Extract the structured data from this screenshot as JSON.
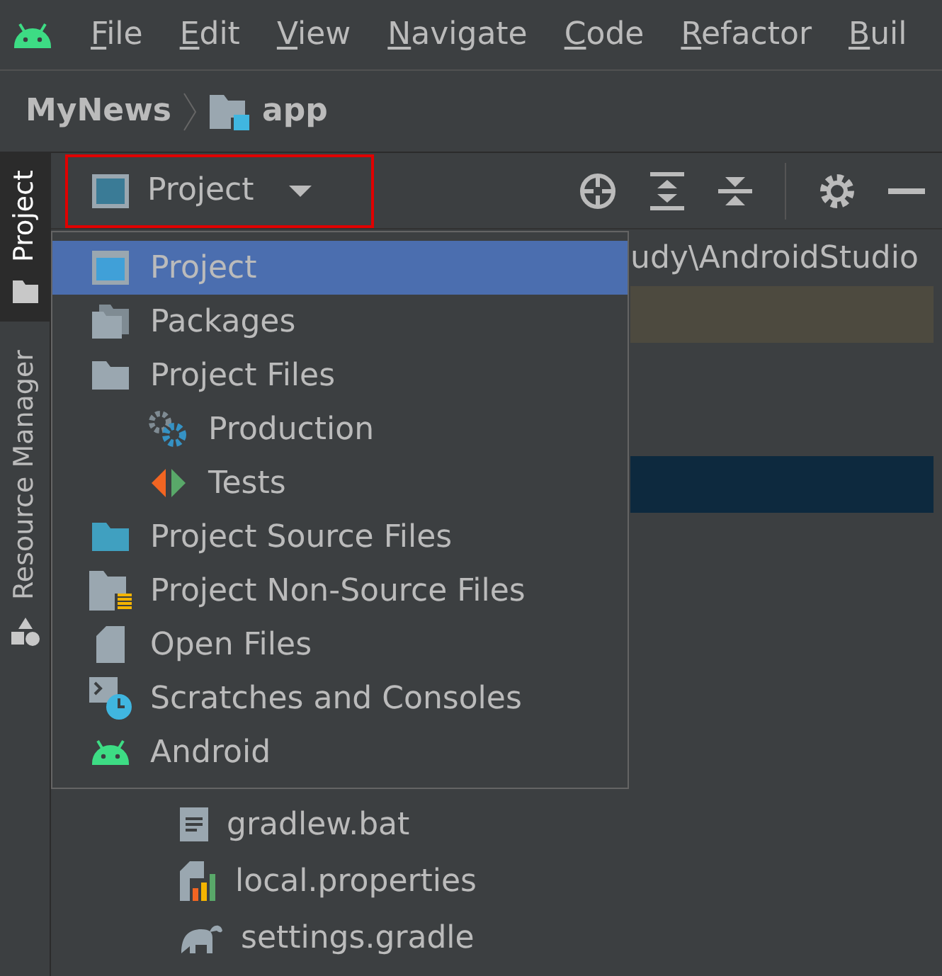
{
  "menu_bar": [
    "File",
    "Edit",
    "View",
    "Navigate",
    "Code",
    "Refactor",
    "Buil"
  ],
  "breadcrumb": {
    "project": "MyNews",
    "module": "app"
  },
  "side_tabs": [
    {
      "label": "Project",
      "selected": true,
      "kind": "folder"
    },
    {
      "label": "Resource Manager",
      "selected": false,
      "kind": "shapes"
    }
  ],
  "view_selector": {
    "label": "Project",
    "highlighted": true
  },
  "tree_rows": [
    {
      "label": "udy\\AndroidStudio",
      "kind": "path"
    },
    {
      "kind": "modified-row"
    },
    {
      "kind": "spacer"
    },
    {
      "kind": "spacer"
    },
    {
      "kind": "selected-row"
    },
    {
      "kind": "spacer"
    },
    {
      "kind": "spacer"
    },
    {
      "kind": "spacer"
    },
    {
      "kind": "spacer"
    },
    {
      "kind": "spacer"
    },
    {
      "label": "gradlew.bat",
      "kind": "text-file"
    },
    {
      "label": "local.properties",
      "kind": "properties"
    },
    {
      "label": "settings.gradle",
      "kind": "gradle"
    }
  ],
  "view_menu": [
    {
      "label": "Project",
      "kind": "project",
      "selected": true
    },
    {
      "label": "Packages",
      "kind": "packages",
      "selected": false
    },
    {
      "label": "Project Files",
      "kind": "folder",
      "selected": false,
      "children": [
        {
          "label": "Production",
          "kind": "gears",
          "selected": false
        },
        {
          "label": "Tests",
          "kind": "tests",
          "selected": false
        }
      ]
    },
    {
      "label": "Project Source Files",
      "kind": "source-folder",
      "selected": false
    },
    {
      "label": "Project Non-Source Files",
      "kind": "nonsource-folder",
      "selected": false
    },
    {
      "label": "Open Files",
      "kind": "file",
      "selected": false
    },
    {
      "label": "Scratches and Consoles",
      "kind": "scratches",
      "selected": false
    },
    {
      "label": "Android",
      "kind": "android",
      "selected": false
    }
  ]
}
